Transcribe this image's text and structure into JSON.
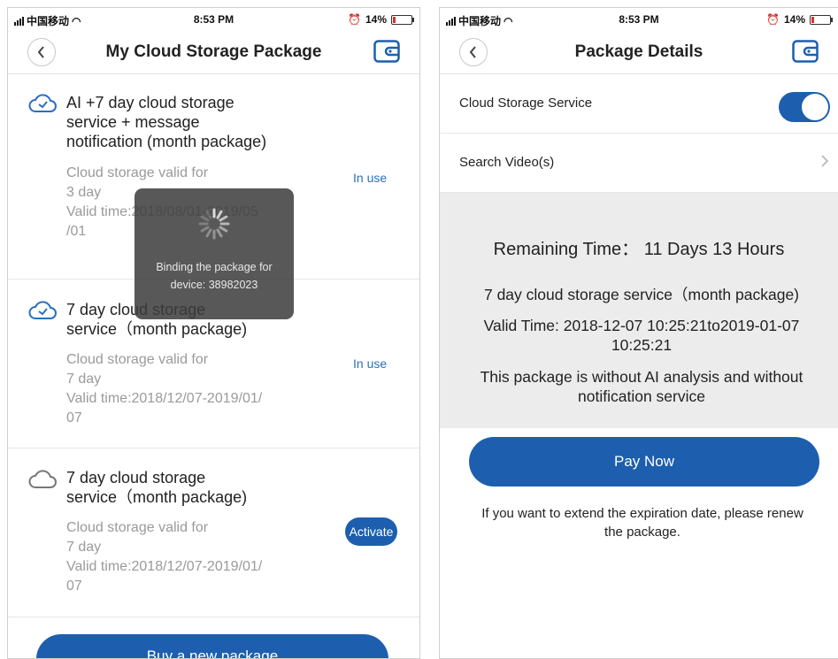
{
  "colors": {
    "accent": "#1d5fae",
    "link_blue": "#2a6fc0",
    "muted_text": "#9a9a9a",
    "panel_grey": "#ececec"
  },
  "left_screen": {
    "status_bar": {
      "carrier": "中国移动",
      "time": "8:53 PM",
      "battery": "14%"
    },
    "nav": {
      "title": "My Cloud Storage Package",
      "back_icon": "chevron-left-icon",
      "wallet_icon": "wallet-icon"
    },
    "packages": [
      {
        "icon": "cloud-sync-icon",
        "title_lines": [
          "AI +7 day cloud storage",
          "service + message",
          "notification (month package)"
        ],
        "detail_lines": [
          "Cloud storage valid for",
          "3 day",
          "Valid time:2018/08/01-2019/05",
          "/01"
        ],
        "status": "In use"
      },
      {
        "icon": "cloud-sync-icon",
        "title_lines": [
          "7 day cloud storage",
          "service（month package)"
        ],
        "detail_lines": [
          "Cloud storage valid for",
          "7 day",
          "Valid time:2018/12/07-2019/01/",
          "07"
        ],
        "status": "In use"
      },
      {
        "icon": "cloud-outline-icon",
        "title_lines": [
          "7 day cloud storage",
          "service（month package)"
        ],
        "detail_lines": [
          "Cloud storage valid for",
          "7 day",
          "Valid time:2018/12/07-2019/01/",
          "07"
        ],
        "status": "Activate"
      }
    ],
    "loading_toast": {
      "icon": "spinner-icon",
      "lines": [
        "Binding the package for",
        "device: 38982023"
      ]
    },
    "buy_button": "Buy a new package"
  },
  "right_screen": {
    "status_bar": {
      "carrier": "中国移动",
      "time": "8:53 PM",
      "battery": "14%"
    },
    "nav": {
      "title": "Package Details",
      "back_icon": "chevron-left-icon",
      "wallet_icon": "wallet-icon"
    },
    "cloud_storage_service": {
      "label": "Cloud Storage Service",
      "enabled": true
    },
    "search_videos": {
      "label": "Search Video(s)"
    },
    "details": {
      "remaining_time": "Remaining Time： 11 Days 13 Hours",
      "package_name": "7 day cloud storage service（month package)",
      "valid_time_lines": [
        "Valid Time: 2018-12-07 10:25:21to2019-01-07",
        "10:25:21"
      ],
      "note_lines": [
        "This package is without AI analysis and without",
        "notification service"
      ]
    },
    "pay_button": "Pay Now",
    "renew_note_lines": [
      "If you want to extend the expiration date, please renew",
      "the package."
    ]
  }
}
